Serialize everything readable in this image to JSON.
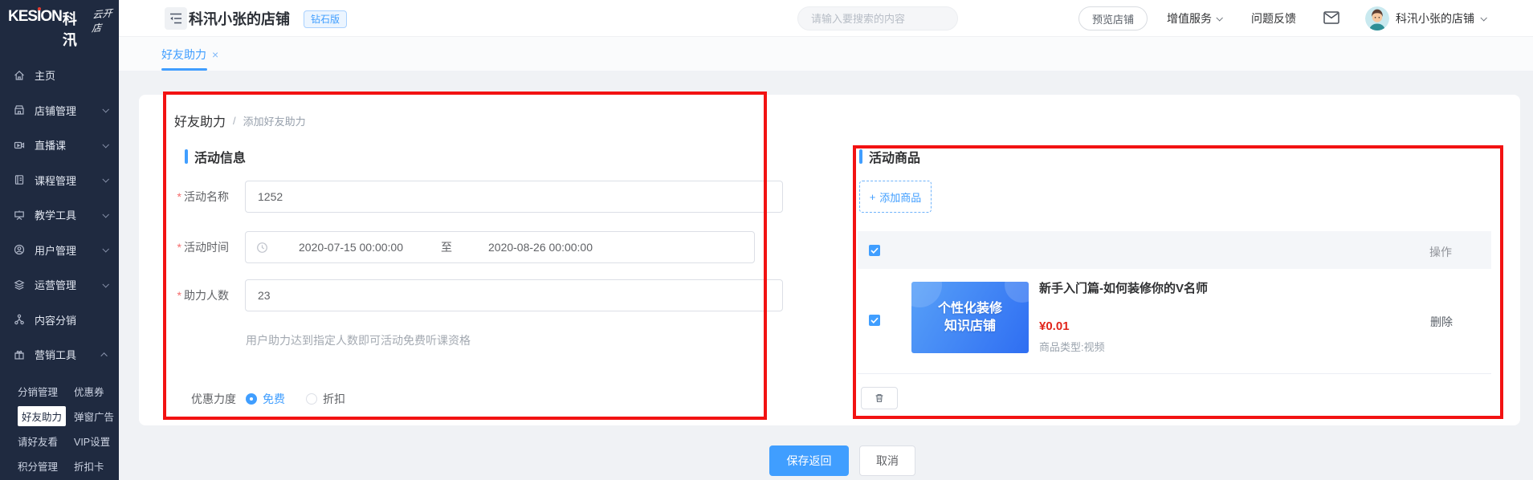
{
  "sidebar": {
    "logo": {
      "brand": "KESION",
      "brand_cn": "科汛",
      "suffix": "云开店"
    },
    "items": [
      {
        "label": "主页"
      },
      {
        "label": "店铺管理"
      },
      {
        "label": "直播课"
      },
      {
        "label": "课程管理"
      },
      {
        "label": "教学工具"
      },
      {
        "label": "用户管理"
      },
      {
        "label": "运营管理"
      },
      {
        "label": "内容分销"
      },
      {
        "label": "营销工具"
      }
    ],
    "submenu": [
      {
        "label": "分销管理"
      },
      {
        "label": "优惠券"
      },
      {
        "label": "好友助力"
      },
      {
        "label": "弹窗广告"
      },
      {
        "label": "请好友看"
      },
      {
        "label": "VIP设置"
      },
      {
        "label": "积分管理"
      },
      {
        "label": "折扣卡"
      }
    ]
  },
  "header": {
    "shop_title": "科汛小张的店铺",
    "badge": "钻石版",
    "search_placeholder": "请输入要搜索的内容",
    "preview_button": "预览店铺",
    "value_added": "增值服务",
    "feedback": "问题反馈",
    "account_name": "科汛小张的店铺"
  },
  "tabs": {
    "active": "好友助力",
    "close": "×"
  },
  "breadcrumb": {
    "root": "好友助力",
    "sep": "/",
    "current": "添加好友助力"
  },
  "form": {
    "section_title": "活动信息",
    "required_mark": "*",
    "name_label": "活动名称",
    "name_value": "1252",
    "time_label": "活动时间",
    "time_start": "2020-07-15 00:00:00",
    "time_sep": "至",
    "time_end": "2020-08-26 00:00:00",
    "count_label": "助力人数",
    "count_value": "23",
    "hint": "用户助力达到指定人数即可活动免费听课资格",
    "discount_label": "优惠力度",
    "radio_free": "免费",
    "radio_discount": "折扣"
  },
  "products": {
    "section_title": "活动商品",
    "add_plus": "+",
    "add_label": "添加商品",
    "action_header": "操作",
    "item": {
      "cover_line1": "个性化装修",
      "cover_line2": "知识店铺",
      "title": "新手入门篇-如何装修你的V名师",
      "price": "¥0.01",
      "type": "商品类型:视频",
      "delete_label": "删除"
    }
  },
  "footer": {
    "save": "保存返回",
    "cancel": "取消"
  },
  "colors": {
    "accent": "#409eff",
    "annotation": "#f21212",
    "price": "#e1251b",
    "sidebar_bg": "#1f2a40"
  }
}
